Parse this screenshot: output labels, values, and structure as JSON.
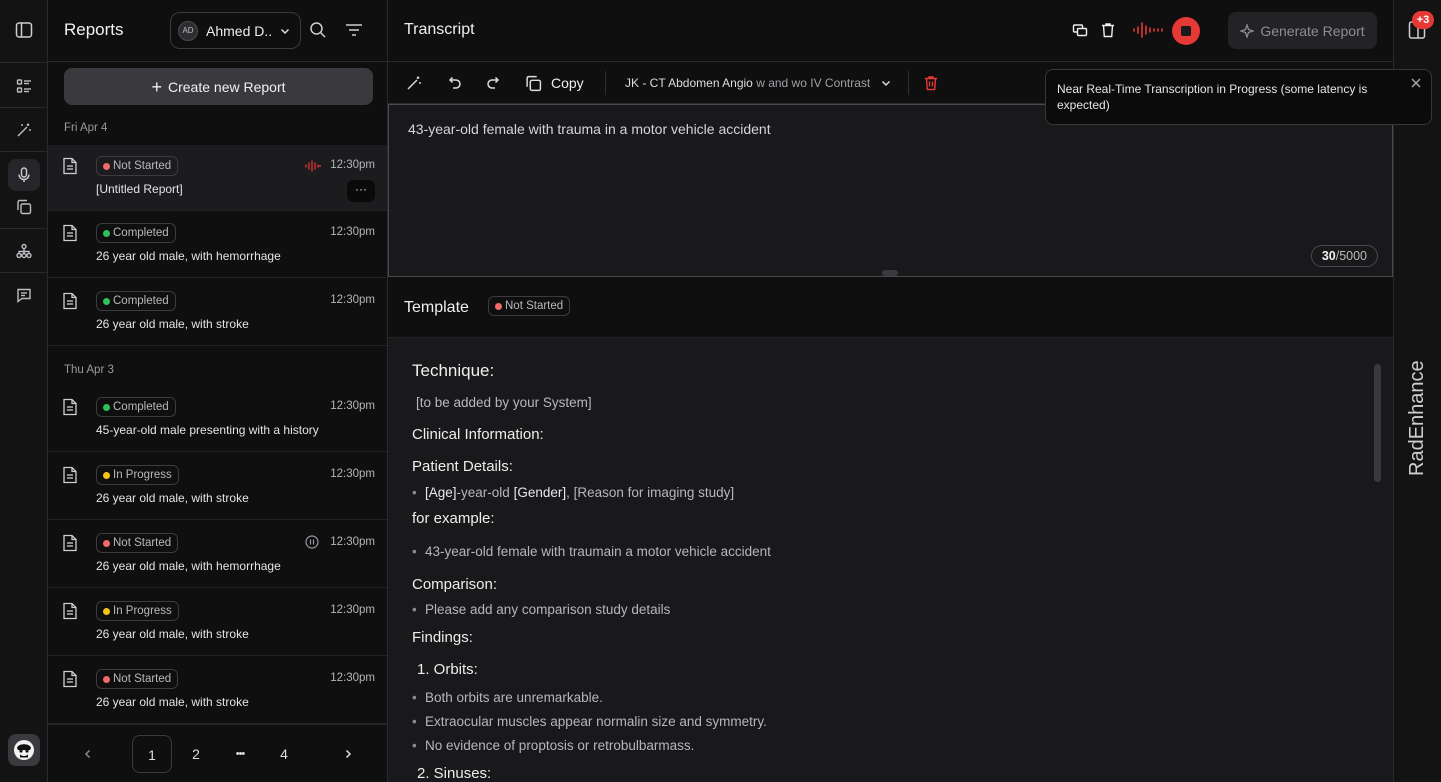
{
  "sidebar": {
    "icons": [
      "sidebar-toggle-icon",
      "list-icon",
      "magic-wand-icon",
      "microphone-icon",
      "copy-icon",
      "hierarchy-icon",
      "chat-icon",
      "user-avatar-icon"
    ]
  },
  "list": {
    "title": "Reports",
    "user": {
      "initials": "AD",
      "name": "Ahmed D.."
    },
    "create_label": "Create new Report",
    "groups": [
      {
        "date": "Fri Apr 4"
      },
      {
        "date": "Thu Apr 3"
      }
    ],
    "reports": [
      {
        "status": "Not Started",
        "time": "12:30pm",
        "title": "[Untitled Report]",
        "indicator": "recording"
      },
      {
        "status": "Completed",
        "time": "12:30pm",
        "title": "26 year old male, with hemorrhage"
      },
      {
        "status": "Completed",
        "time": "12:30pm",
        "title": "26 year old male, with stroke"
      },
      {
        "status": "Completed",
        "time": "12:30pm",
        "title": "45-year-old male presenting with a history"
      },
      {
        "status": "In Progress",
        "time": "12:30pm",
        "title": "26 year old male, with stroke"
      },
      {
        "status": "Not Started",
        "time": "12:30pm",
        "title": "26 year old male, with hemorrhage",
        "indicator": "paused"
      },
      {
        "status": "In Progress",
        "time": "12:30pm",
        "title": "26 year old male, with stroke"
      },
      {
        "status": "Not Started",
        "time": "12:30pm",
        "title": "26 year old male, with stroke"
      }
    ],
    "more_label": "···",
    "pagination": {
      "pages": [
        "1",
        "2",
        "•••",
        "4"
      ],
      "current": "1"
    }
  },
  "status_colors": {
    "Not Started": "#f06a6a",
    "Completed": "#2fc25b",
    "In Progress": "#f5c518"
  },
  "transcript": {
    "title": "Transcript",
    "generate_label": "Generate Report",
    "copy_label": "Copy",
    "template_name": "JK - CT Abdomen Angio",
    "template_suffix": "w and wo IV Contrast",
    "text": "43-year-old female with trauma in a motor vehicle accident",
    "count": "30",
    "limit": "/5000"
  },
  "template": {
    "title": "Template",
    "status": "Not Started",
    "technique_heading": "Technique:",
    "technique_text": "[to be added by your System]",
    "clinical_heading": "Clinical Information:",
    "patient_heading": "Patient Details:",
    "patient_item": {
      "a": "[Age]",
      "b": "-year-old ",
      "c": "[Gender]",
      "d": ", [Reason for imaging study]"
    },
    "example_heading": "for example:",
    "example_item": "43-year-old female with traumain a motor vehicle accident",
    "comparison_heading": "Comparison:",
    "comparison_item": "Please add any comparison study details",
    "findings_heading": "Findings:",
    "orbits_heading": "1. Orbits:",
    "orbits_items": [
      "Both orbits are unremarkable.",
      "Extraocular muscles appear normalin size and symmetry.",
      "No evidence of proptosis or retrobulbarmass."
    ],
    "sinuses_heading": "2. Sinuses:"
  },
  "right_panel": {
    "count": "+3",
    "brand": "RadEnhance"
  },
  "toast": {
    "message": "Near Real-Time Transcription in Progress (some latency is expected)"
  },
  "colors": {
    "accent_red": "#e53935"
  }
}
